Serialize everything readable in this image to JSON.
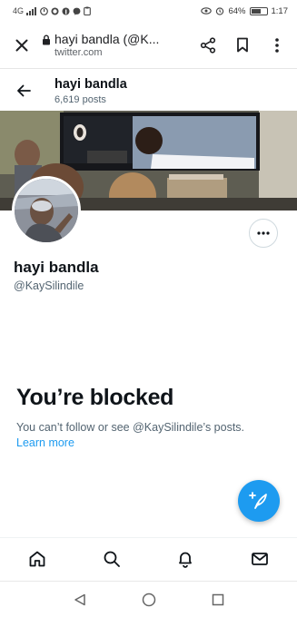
{
  "status_bar": {
    "left_icons": [
      "signal-icon",
      "notification-icon",
      "whatsapp-icon",
      "facebook-icon",
      "messenger-icon",
      "clipboard-icon"
    ],
    "network": "4G",
    "battery_percent": "64%",
    "battery_level": 0.64,
    "time": "1:17"
  },
  "browser": {
    "page_title": "hayi bandla (@K...",
    "domain": "twitter.com"
  },
  "profile": {
    "header_name": "hayi bandla",
    "post_count": "6,619 posts",
    "display_name": "hayi bandla",
    "handle": "@KaySilindile"
  },
  "blocked": {
    "title": "You’re blocked",
    "description": "You can’t follow or see @KaySilindile’s posts.",
    "learn_more": "Learn more"
  },
  "bottom_nav": {
    "items": [
      "home-icon",
      "search-icon",
      "notifications-icon",
      "messages-icon"
    ]
  },
  "android_nav": {
    "items": [
      "back-icon",
      "home-circle-icon",
      "recents-icon"
    ]
  },
  "colors": {
    "accent": "#1d9bf0",
    "text_primary": "#0f1419",
    "text_secondary": "#536471"
  }
}
